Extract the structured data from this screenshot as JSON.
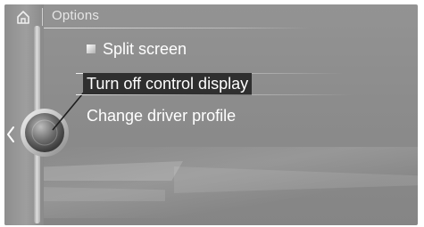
{
  "header": {
    "title": "Options",
    "home_icon": "home-icon"
  },
  "menu": {
    "items": [
      {
        "label": "Split screen",
        "icon": "checkbox-icon"
      },
      {
        "label": "Turn off control display",
        "selected": true
      },
      {
        "label": "Change driver profile"
      }
    ]
  },
  "controller": {
    "back_icon": "chevron-left-icon",
    "knob_icon": "controller-knob-icon"
  },
  "colors": {
    "background": "#8c8c8c",
    "highlight": "#2f2f2f",
    "text": "#ffffff"
  }
}
